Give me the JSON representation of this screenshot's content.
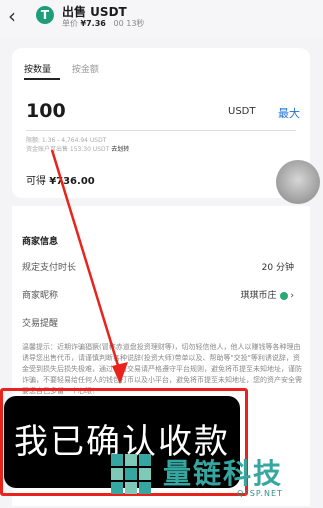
{
  "header": {
    "back_icon": "chevron-left-icon",
    "token_icon": "usdt-icon",
    "title": "出售 USDT",
    "price_label": "单价",
    "price_value": "¥7.36",
    "timer": "00 13秒"
  },
  "order_card": {
    "tabs": [
      {
        "label": "按数量",
        "active": true
      },
      {
        "label": "按金额",
        "active": false
      }
    ],
    "amount": "100",
    "unit": "USDT",
    "max_label": "最大",
    "limit_line1": "限额: 1.36 - 4,764.94 USDT",
    "limit_line2": "资金账户可出售 153.30 USDT",
    "transfer_label": "去划转",
    "receive_label": "可得",
    "receive_value": "¥736.00"
  },
  "merchant": {
    "section_title": "商家信息",
    "payment_time_label": "规定支付时长",
    "payment_time_value": "20 分钟",
    "nickname_label": "商家昵称",
    "nickname_value": "琪琪币庄",
    "trade_tips_label": "交易提醒",
    "notice": "温馨提示：近期诈骗猖獗(冒称赤道盘投资理财等)，切勿轻信他人，他人以赚钱等各种理由诱导您出售代币，请谨慎判断各种说辞(投资大师)带单以及、帮助等\"交投\"等利诱说辞，资金受到损失后损失极难，通过平台交易请严格遵守平台规则，避免将币提至未知地址，谨防诈骗，不要轻易给任何人的钱包打币以及小平台，避免将币提至未知地址，您的资产安全需要您自己多留一个心眼！",
    "colors": {
      "badge": "#2aa876"
    }
  },
  "action": {
    "confirm_label": "我已确认收款",
    "highlight_color": "#e8231c"
  },
  "watermark": {
    "name": "量链科技",
    "domain": "QFSP.NET",
    "color": "#35a6a0"
  },
  "misc": {
    "floating_button": "assistive-touch-icon"
  }
}
